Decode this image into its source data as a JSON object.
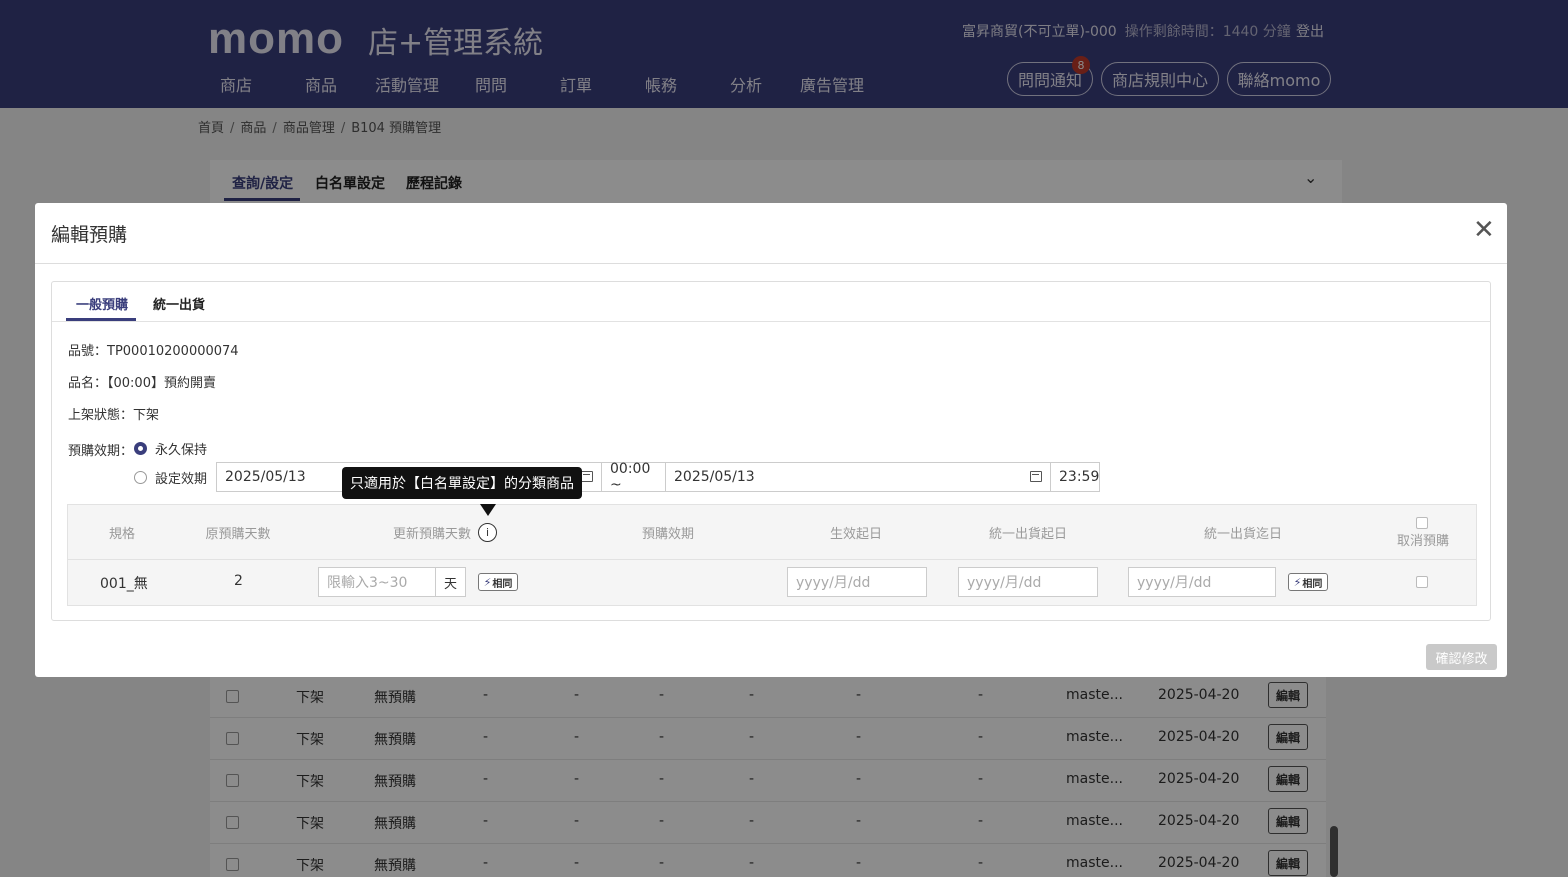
{
  "header": {
    "logo": "momo",
    "system_title": "店+管理系統",
    "nav": [
      "商店",
      "商品",
      "活動管理",
      "問問",
      "訂單",
      "帳務",
      "分析",
      "廣告管理"
    ],
    "account": "富昇商貿(不可立單)-000",
    "session_time": "操作剩餘時間：1440 分鐘",
    "logout": "登出",
    "pills": [
      "問問通知",
      "商店規則中心",
      "聯絡momo"
    ],
    "notification_count": "8"
  },
  "breadcrumb": [
    "首頁",
    "商品",
    "商品管理",
    "B104 預購管理"
  ],
  "page_tabs": [
    "查詢/設定",
    "白名單設定",
    "歷程記錄"
  ],
  "background_table": {
    "rows": [
      {
        "status": "下架",
        "preorder": "無預購",
        "dashes": [
          "-",
          "-",
          "-",
          "-",
          "-",
          "-"
        ],
        "user": "maste...",
        "date": "2025-04-20",
        "edit": "編輯"
      },
      {
        "status": "下架",
        "preorder": "無預購",
        "dashes": [
          "-",
          "-",
          "-",
          "-",
          "-",
          "-"
        ],
        "user": "maste...",
        "date": "2025-04-20",
        "edit": "編輯"
      },
      {
        "status": "下架",
        "preorder": "無預購",
        "dashes": [
          "-",
          "-",
          "-",
          "-",
          "-",
          "-"
        ],
        "user": "maste...",
        "date": "2025-04-20",
        "edit": "編輯"
      },
      {
        "status": "下架",
        "preorder": "無預購",
        "dashes": [
          "-",
          "-",
          "-",
          "-",
          "-",
          "-"
        ],
        "user": "maste...",
        "date": "2025-04-20",
        "edit": "編輯"
      },
      {
        "status": "下架",
        "preorder": "無預購",
        "dashes": [
          "-",
          "-",
          "-",
          "-",
          "-",
          "-"
        ],
        "user": "maste...",
        "date": "2025-04-20",
        "edit": "編輯"
      }
    ]
  },
  "modal": {
    "title": "編輯預購",
    "close_icon": "close-icon",
    "tabs": [
      "一般預購",
      "統一出貨"
    ],
    "product_no": "品號：TP00010200000074",
    "product_name": "品名：【00:00】預約開賣",
    "listing_status": "上架狀態：下架",
    "validity_label": "預購效期：",
    "option_forever": "永久保持",
    "option_set": "設定效期",
    "start_date": "2025/05/13",
    "start_time": "00:00 ~",
    "end_date": "2025/05/13",
    "end_time": "23:59",
    "tooltip": "只適用於【白名單設定】的分類商品",
    "columns": [
      "規格",
      "原預購天數",
      "更新預購天數",
      "預購效期",
      "生效起日",
      "統一出貨起日",
      "統一出貨迄日",
      "取消預購"
    ],
    "row": {
      "spec": "001_無",
      "orig_days": "2",
      "days_placeholder": "限輸入3~30",
      "unit": "天",
      "same_label": "相同",
      "date_placeholder": "yyyy/月/dd"
    },
    "confirm": "確認修改"
  }
}
